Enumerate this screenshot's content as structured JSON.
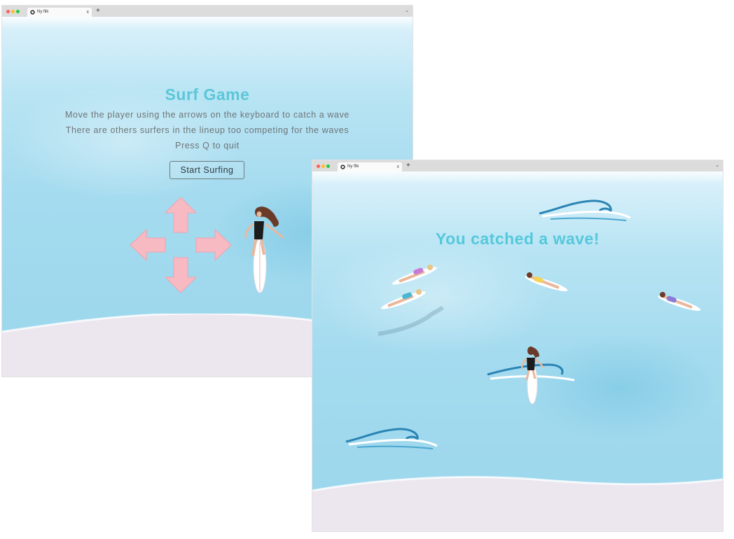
{
  "start_window": {
    "tab": {
      "title": "Ny flik",
      "close": "x",
      "new_tab": "+",
      "menu": "⌄"
    },
    "game": {
      "title": "Surf Game",
      "instructions": [
        "Move the player using the arrows on the keyboard to catch a wave",
        "There are others surfers in the lineup too competing for the waves",
        "Press Q to quit"
      ],
      "start_button": "Start Surfing"
    }
  },
  "play_window": {
    "tab": {
      "title": "Ny flik",
      "close": "x",
      "new_tab": "+",
      "menu": "⌄"
    },
    "message": "You catched a wave!"
  },
  "colors": {
    "title": "#5bc7d9",
    "water": "#a4dbef",
    "sand": "#ece6ee",
    "arrow": "#f7b9c2"
  }
}
